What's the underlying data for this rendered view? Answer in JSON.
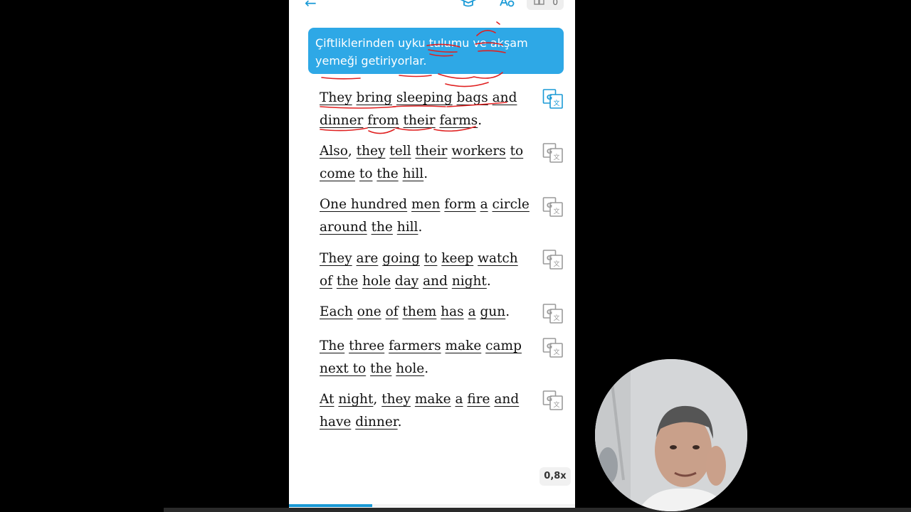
{
  "header": {
    "back_icon": "back-arrow-icon",
    "study_icon": "graduation-cap-icon",
    "font_icon": "font-size-icon",
    "pages_icon": "book-pages-icon",
    "page_count": "0"
  },
  "translation_bubble": {
    "text": "Çiftliklerinden uyku tulumu ve akşam yemeği getiriyorlar."
  },
  "sentences": [
    {
      "words": [
        "They",
        "bring",
        "sleeping",
        "bags",
        "and",
        "dinner",
        "from",
        "their",
        "farms"
      ],
      "punct": "."
    },
    {
      "words": [
        "Also",
        ",",
        "they",
        "tell",
        "their",
        "workers",
        "to",
        "come",
        "to",
        "the",
        "hill"
      ],
      "punct": "."
    },
    {
      "words": [
        "One hundred",
        "men",
        "form",
        "a",
        "circle",
        "around",
        "the",
        "hill"
      ],
      "punct": "."
    },
    {
      "words": [
        "They",
        "are",
        "going",
        "to",
        "keep",
        "watch",
        "of",
        "the",
        "hole",
        "day",
        "and",
        "night"
      ],
      "punct": "."
    },
    {
      "words": [
        "Each",
        "one",
        "of",
        "them",
        "has",
        "a",
        "gun"
      ],
      "punct": "."
    },
    {
      "words": [
        "The",
        "three",
        "farmers",
        "make",
        "camp",
        "next to",
        "the",
        "hole"
      ],
      "punct": "."
    },
    {
      "words": [
        "At",
        "night",
        ",",
        "they",
        "make",
        "a",
        "fire",
        "and",
        "have",
        "dinner"
      ],
      "punct": "."
    }
  ],
  "translate_icon": "google-translate-icon",
  "playback": {
    "speed": "0,8x",
    "progress": 0.29
  },
  "accent_color": "#1a9ad6",
  "bubble_color": "#2ea8e6",
  "annotation_color": "#e02020"
}
